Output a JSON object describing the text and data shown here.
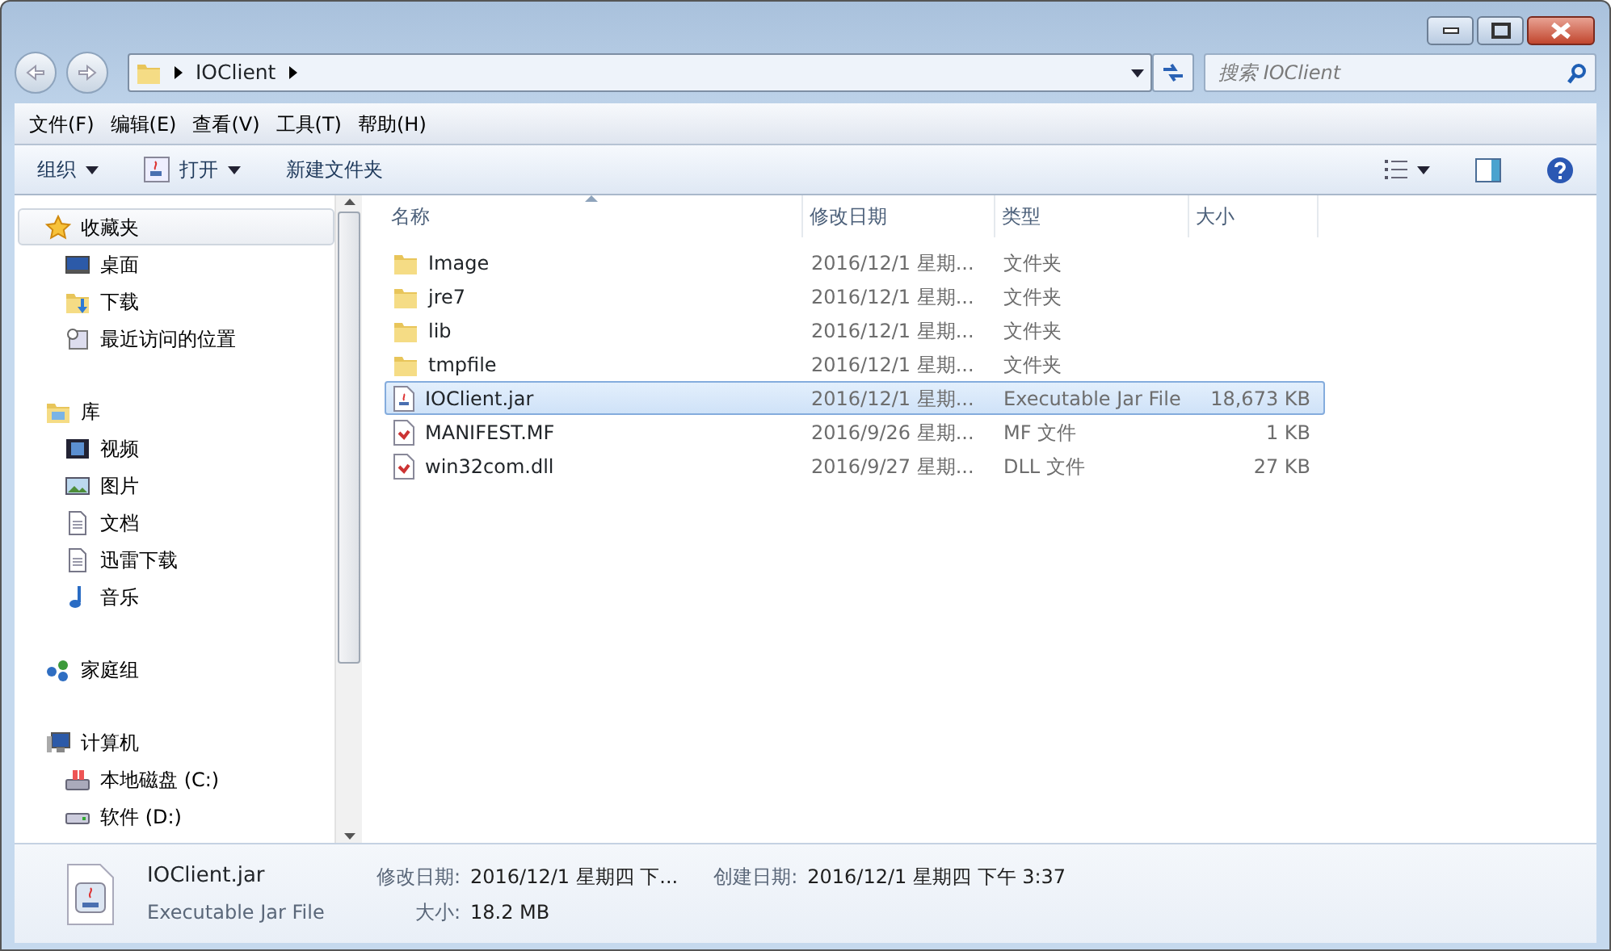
{
  "address": {
    "segments": [
      "IOClient"
    ]
  },
  "search": {
    "placeholder": "搜索 IOClient"
  },
  "menu": [
    "文件(F)",
    "编辑(E)",
    "查看(V)",
    "工具(T)",
    "帮助(H)"
  ],
  "toolbar": [
    {
      "kind": "plain",
      "label": "组织",
      "dropdown": true
    },
    {
      "kind": "open",
      "label": "打开",
      "dropdown": true
    },
    {
      "kind": "plain",
      "label": "新建文件夹",
      "dropdown": false
    }
  ],
  "sidebar": [
    {
      "kind": "star",
      "label": "收藏夹",
      "selected": true,
      "children": [
        {
          "kind": "desktop",
          "label": "桌面"
        },
        {
          "kind": "download",
          "label": "下载"
        },
        {
          "kind": "recent",
          "label": "最近访问的位置"
        }
      ]
    },
    {
      "kind": "library",
      "label": "库",
      "selected": false,
      "children": [
        {
          "kind": "video",
          "label": "视频"
        },
        {
          "kind": "picture",
          "label": "图片"
        },
        {
          "kind": "doc",
          "label": "文档"
        },
        {
          "kind": "doc",
          "label": "迅雷下载"
        },
        {
          "kind": "music",
          "label": "音乐"
        }
      ]
    },
    {
      "kind": "homegroup",
      "label": "家庭组",
      "selected": false
    },
    {
      "kind": "computer",
      "label": "计算机",
      "selected": false,
      "children": [
        {
          "kind": "disk",
          "label": "本地磁盘 (C:)"
        },
        {
          "kind": "drive",
          "label": "软件 (D:)"
        }
      ]
    }
  ],
  "table": {
    "columns": [
      {
        "label": "名称",
        "sorted": true
      },
      {
        "label": "修改日期",
        "sorted": false
      },
      {
        "label": "类型",
        "sorted": false
      },
      {
        "label": "大小",
        "sorted": false
      }
    ],
    "rows": [
      {
        "kind": "folder",
        "name": "Image",
        "date": "2016/12/1 星期...",
        "type": "文件夹",
        "size": "",
        "selected": false
      },
      {
        "kind": "folder",
        "name": "jre7",
        "date": "2016/12/1 星期...",
        "type": "文件夹",
        "size": "",
        "selected": false
      },
      {
        "kind": "folder",
        "name": "lib",
        "date": "2016/12/1 星期...",
        "type": "文件夹",
        "size": "",
        "selected": false
      },
      {
        "kind": "folder",
        "name": "tmpfile",
        "date": "2016/12/1 星期...",
        "type": "文件夹",
        "size": "",
        "selected": false
      },
      {
        "kind": "jar",
        "name": "IOClient.jar",
        "date": "2016/12/1 星期...",
        "type": "Executable Jar File",
        "size": "18,673 KB",
        "selected": true
      },
      {
        "kind": "file",
        "name": "MANIFEST.MF",
        "date": "2016/9/26 星期...",
        "type": "MF 文件",
        "size": "1 KB",
        "selected": false
      },
      {
        "kind": "file",
        "name": "win32com.dll",
        "date": "2016/9/27 星期...",
        "type": "DLL 文件",
        "size": "27 KB",
        "selected": false
      }
    ]
  },
  "details": {
    "name": "IOClient.jar",
    "type": "Executable Jar File",
    "fields": [
      {
        "label": "修改日期:",
        "value": "2016/12/1 星期四 下..."
      },
      {
        "label": "创建日期:",
        "value": "2016/12/1 星期四 下午 3:37"
      },
      {
        "label": "大小:",
        "value": "18.2 MB"
      }
    ]
  }
}
